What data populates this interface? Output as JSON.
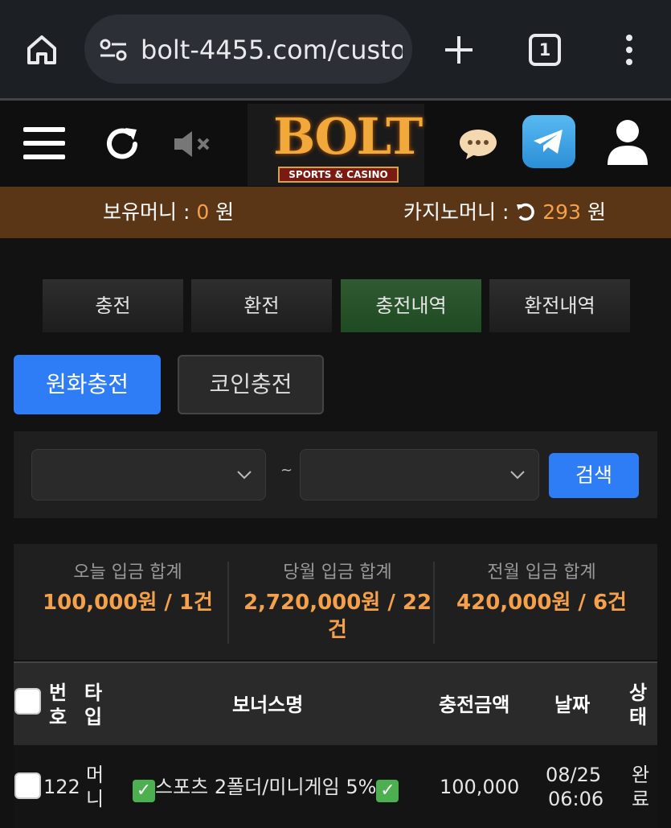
{
  "browser": {
    "url": "bolt-4455.com/custo",
    "tab_count": "1"
  },
  "header": {
    "logo_main": "BOLT",
    "logo_sub": "SPORTS & CASINO"
  },
  "balance": {
    "money_label": "보유머니 : ",
    "money_value": "0",
    "money_unit": " 원",
    "casino_label": "카지노머니 : ",
    "casino_value": "293",
    "casino_unit": " 원"
  },
  "tabs": [
    {
      "label": "충전"
    },
    {
      "label": "환전"
    },
    {
      "label": "충전내역"
    },
    {
      "label": "환전내역"
    }
  ],
  "active_tab": 2,
  "subtabs": {
    "won": "원화충전",
    "coin": "코인충전"
  },
  "search": {
    "tilde": "~",
    "button": "검색"
  },
  "stats": [
    {
      "label": "오늘 입금 합계",
      "value": "100,000원 / 1건"
    },
    {
      "label": "당월 입금 합계",
      "value": "2,720,000원 / 22건"
    },
    {
      "label": "전월 입금 합계",
      "value": "420,000원 / 6건"
    }
  ],
  "table": {
    "headers": {
      "number": "번호",
      "type": "타입",
      "bonus": "보너스명",
      "amount": "충전금액",
      "date": "날짜",
      "status": "상태"
    },
    "rows": [
      {
        "number": "122",
        "type": "머니",
        "bonus": "스포츠 2폴더/미니게임 5%",
        "amount": "100,000",
        "date": "08/25",
        "time": "06:06",
        "status": "완료"
      }
    ]
  },
  "colors": {
    "accent_orange": "#f5a04a",
    "primary_blue": "#2f7df6",
    "active_tab_green": "#2f5a32",
    "balance_bar_brown": "#5a3616"
  }
}
